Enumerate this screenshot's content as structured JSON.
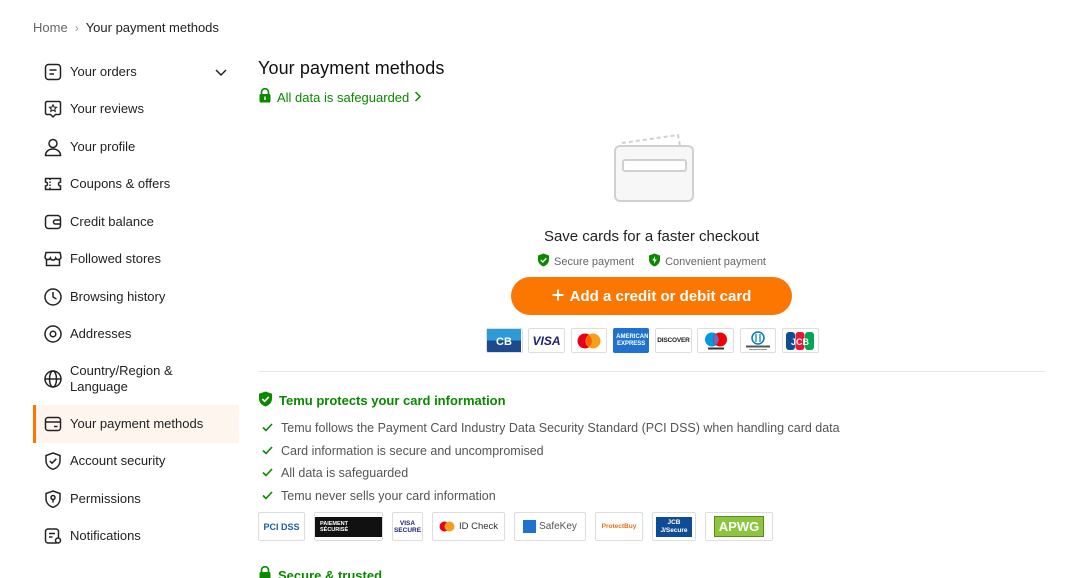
{
  "breadcrumb": {
    "home": "Home",
    "separator": "›",
    "current": "Your payment methods"
  },
  "sidebar": {
    "items": [
      {
        "label": "Your orders",
        "icon": "orders-icon",
        "has_chevron": true
      },
      {
        "label": "Your reviews",
        "icon": "reviews-icon"
      },
      {
        "label": "Your profile",
        "icon": "profile-icon"
      },
      {
        "label": "Coupons & offers",
        "icon": "coupon-icon"
      },
      {
        "label": "Credit balance",
        "icon": "wallet-icon"
      },
      {
        "label": "Followed stores",
        "icon": "store-icon"
      },
      {
        "label": "Browsing history",
        "icon": "clock-icon"
      },
      {
        "label": "Addresses",
        "icon": "location-icon"
      },
      {
        "label": "Country/Region & Language",
        "icon": "globe-icon"
      },
      {
        "label": "Your payment methods",
        "icon": "card-icon",
        "active": true
      },
      {
        "label": "Account security",
        "icon": "shield-icon"
      },
      {
        "label": "Permissions",
        "icon": "permission-icon"
      },
      {
        "label": "Notifications",
        "icon": "notification-icon"
      }
    ]
  },
  "main": {
    "title": "Your payment methods",
    "safeguard_link": "All data is safeguarded",
    "empty_state": {
      "title": "Save cards for a faster checkout",
      "badges": [
        "Secure payment",
        "Convenient payment"
      ],
      "add_button": "Add a credit or debit card"
    },
    "card_brands": [
      "CB",
      "VISA",
      "Mastercard",
      "AMERICAN EXPRESS",
      "DISCOVER",
      "Maestro",
      "Diners Club",
      "JCB"
    ],
    "protect": {
      "title": "Temu protects your card information",
      "items": [
        "Temu follows the Payment Card Industry Data Security Standard (PCI DSS) when handling card data",
        "Card information is secure and uncompromised",
        "All data is safeguarded",
        "Temu never sells your card information"
      ],
      "security_logos": [
        "PCI DSS",
        "PAIEMENT SÉCURISÉ",
        "VISA SECURE",
        "ID Check",
        "SafeKey",
        "ProtectBuy",
        "JCB J/Secure",
        "APWG"
      ]
    },
    "trusted_title": "Secure & trusted"
  },
  "colors": {
    "accent": "#fb7701",
    "green": "#0a8800",
    "active_bg": "#fff5ef"
  }
}
